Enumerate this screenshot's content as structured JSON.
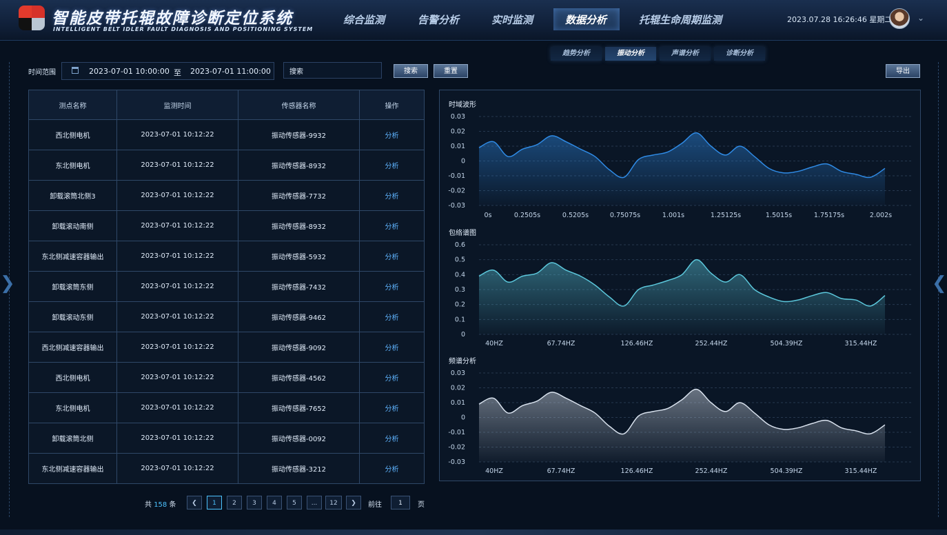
{
  "header": {
    "title": "智能皮带托辊故障诊断定位系统",
    "subtitle": "INTELLIGENT BELT IDLER FAULT DIAGNOSIS AND POSITIONING SYSTEM",
    "nav": [
      {
        "label": "综合监测"
      },
      {
        "label": "告警分析"
      },
      {
        "label": "实时监测"
      },
      {
        "label": "数据分析",
        "active": true
      },
      {
        "label": "托辊生命周期监测"
      }
    ],
    "datetime": "2023.07.28 16:26:46  星期二"
  },
  "subtabs": [
    {
      "label": "趋势分析"
    },
    {
      "label": "振动分析",
      "active": true
    },
    {
      "label": "声谱分析"
    },
    {
      "label": "诊断分析"
    }
  ],
  "filters": {
    "time_range_label": "时间范围",
    "start": "2023-07-01 10:00:00",
    "separator": "至",
    "end": "2023-07-01 11:00:00",
    "search_value": "搜索",
    "search_button": "搜索",
    "reset_button": "重置",
    "export_button": "导出"
  },
  "table": {
    "columns": [
      "测点名称",
      "监测时间",
      "传感器名称",
      "操作"
    ],
    "rows": [
      [
        "西北侧电机",
        "2023-07-01 10:12:22",
        "振动传感器-9932",
        "分析"
      ],
      [
        "东北侧电机",
        "2023-07-01 10:12:22",
        "振动传感器-8932",
        "分析"
      ],
      [
        "卸载滚筒北侧3",
        "2023-07-01 10:12:22",
        "振动传感器-7732",
        "分析"
      ],
      [
        "卸载滚动南侧",
        "2023-07-01 10:12:22",
        "振动传感器-8932",
        "分析"
      ],
      [
        "东北侧减速容器输出",
        "2023-07-01 10:12:22",
        "振动传感器-5932",
        "分析"
      ],
      [
        "卸载滚筒东侧",
        "2023-07-01 10:12:22",
        "振动传感器-7432",
        "分析"
      ],
      [
        "卸载滚动东侧",
        "2023-07-01 10:12:22",
        "振动传感器-9462",
        "分析"
      ],
      [
        "西北侧减速容器输出",
        "2023-07-01 10:12:22",
        "振动传感器-9092",
        "分析"
      ],
      [
        "西北侧电机",
        "2023-07-01 10:12:22",
        "振动传感器-4562",
        "分析"
      ],
      [
        "东北侧电机",
        "2023-07-01 10:12:22",
        "振动传感器-7652",
        "分析"
      ],
      [
        "卸载滚筒北侧",
        "2023-07-01 10:12:22",
        "振动传感器-0092",
        "分析"
      ],
      [
        "东北侧减速容器输出",
        "2023-07-01 10:12:22",
        "振动传感器-3212",
        "分析"
      ]
    ]
  },
  "pagination": {
    "total_prefix": "共",
    "total": "158",
    "total_suffix": "条",
    "pages": [
      "1",
      "2",
      "3",
      "4",
      "5",
      "...",
      "12"
    ],
    "current": "1",
    "goto_label": "前往",
    "goto_value": "1",
    "goto_suffix": "页"
  },
  "colors": {
    "accent": "#4cc3ff",
    "waveform": "#2f8be6",
    "envelope": "#5cc8dc",
    "spectrum": "#d9e2ee"
  },
  "chart_data": [
    {
      "type": "area",
      "title": "时域波形",
      "x_tick_labels": [
        "0s",
        "0.2505s",
        "0.5205s",
        "0.75075s",
        "1.001s",
        "1.25125s",
        "1.5015s",
        "1.75175s",
        "2.002s"
      ],
      "y_ticks": [
        "0.03",
        "0.02",
        "0.01",
        "0",
        "-0.01",
        "-0.02",
        "-0.03"
      ],
      "ylim": [
        -0.03,
        0.03
      ],
      "values": [
        0.009,
        0.013,
        0.003,
        0.008,
        0.011,
        0.017,
        0.013,
        0.008,
        0.003,
        -0.006,
        -0.011,
        0.001,
        0.004,
        0.006,
        0.012,
        0.019,
        0.01,
        0.004,
        0.01,
        0.003,
        -0.005,
        -0.008,
        -0.007,
        -0.004,
        -0.002,
        -0.007,
        -0.009,
        -0.011,
        -0.005
      ]
    },
    {
      "type": "area",
      "title": "包络谱图",
      "x_tick_labels": [
        "40HZ",
        "67.74HZ",
        "126.46HZ",
        "252.44HZ",
        "504.39HZ",
        "315.44HZ"
      ],
      "y_ticks": [
        "0.6",
        "0.5",
        "0.4",
        "0.3",
        "0.2",
        "0.1",
        "0"
      ],
      "ylim": [
        0,
        0.6
      ],
      "values": [
        0.39,
        0.43,
        0.35,
        0.39,
        0.41,
        0.48,
        0.43,
        0.39,
        0.33,
        0.25,
        0.19,
        0.3,
        0.33,
        0.36,
        0.4,
        0.5,
        0.41,
        0.35,
        0.4,
        0.3,
        0.25,
        0.22,
        0.23,
        0.26,
        0.28,
        0.24,
        0.23,
        0.19,
        0.26
      ]
    },
    {
      "type": "area",
      "title": "频谱分析",
      "x_tick_labels": [
        "40HZ",
        "67.74HZ",
        "126.46HZ",
        "252.44HZ",
        "504.39HZ",
        "315.44HZ"
      ],
      "y_ticks": [
        "0.03",
        "0.02",
        "0.01",
        "0",
        "-0.01",
        "-0.02",
        "-0.03"
      ],
      "ylim": [
        -0.03,
        0.03
      ],
      "values": [
        0.009,
        0.013,
        0.003,
        0.008,
        0.011,
        0.017,
        0.013,
        0.008,
        0.003,
        -0.006,
        -0.011,
        0.001,
        0.004,
        0.006,
        0.012,
        0.019,
        0.01,
        0.004,
        0.01,
        0.003,
        -0.005,
        -0.008,
        -0.007,
        -0.004,
        -0.002,
        -0.007,
        -0.009,
        -0.011,
        -0.005
      ]
    }
  ]
}
